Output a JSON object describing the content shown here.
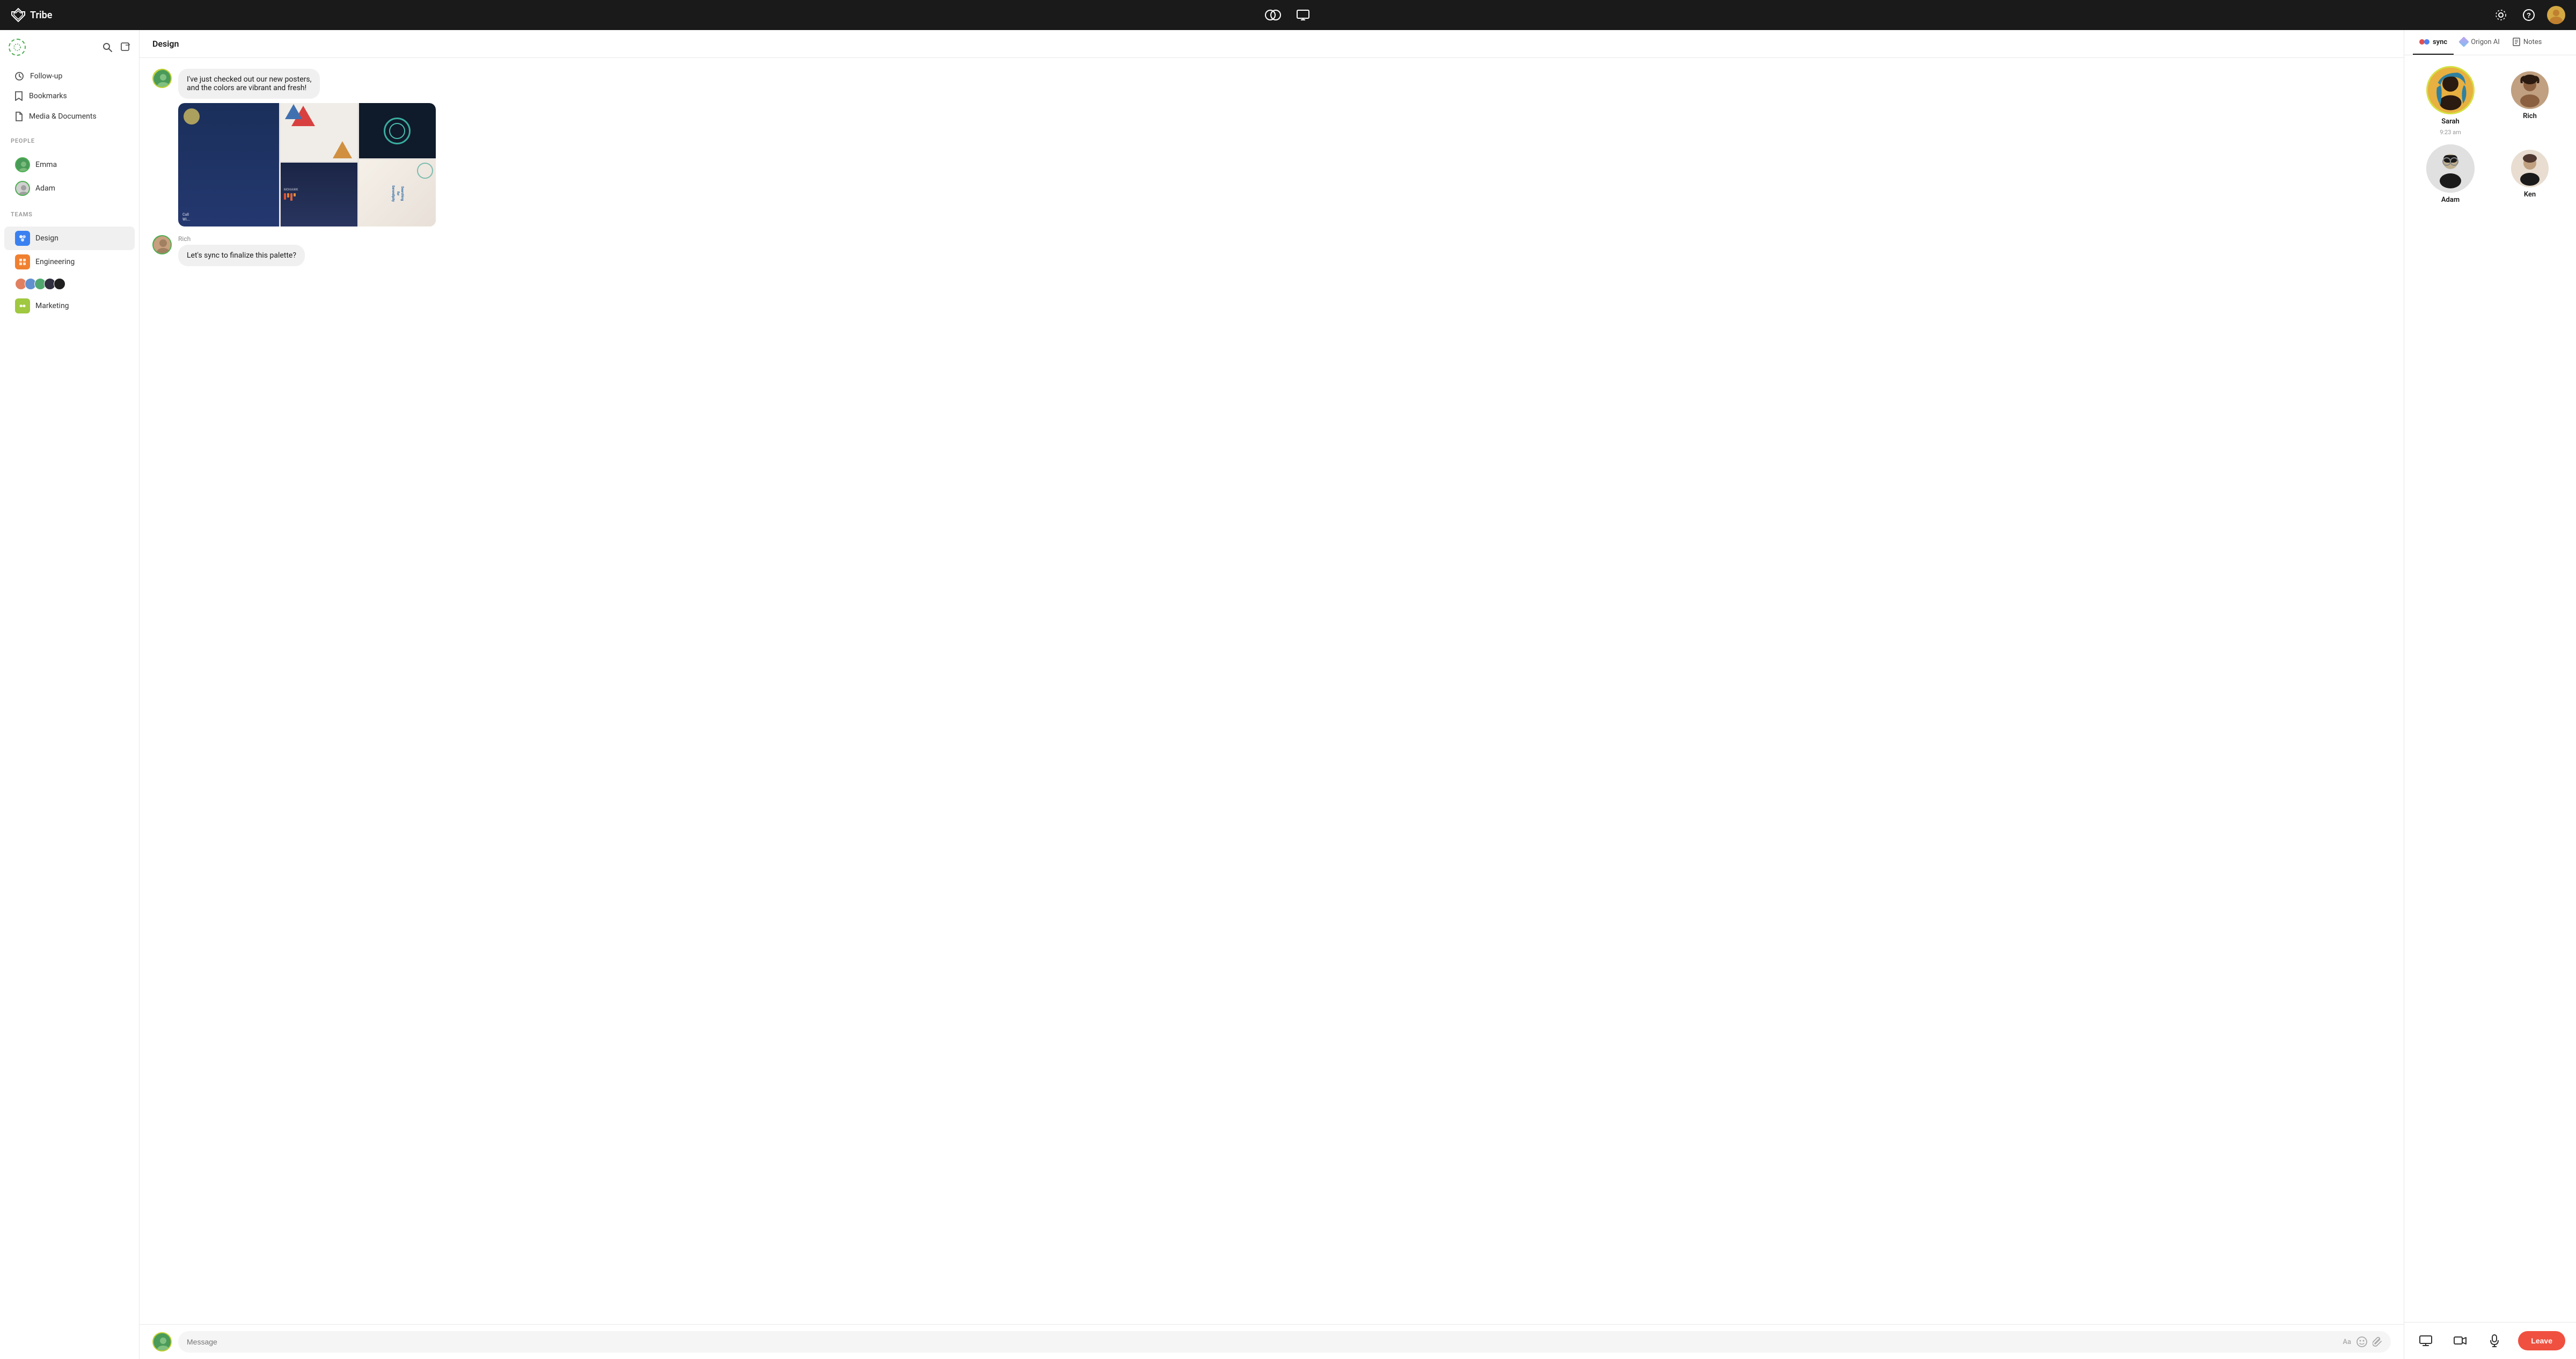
{
  "app": {
    "name": "Tribe",
    "logo_alt": "Tribe logo"
  },
  "topnav": {
    "center_icons": [
      "linked-circles",
      "screen-share"
    ],
    "right_icons": [
      "settings",
      "help"
    ],
    "user_avatar": "user-avatar"
  },
  "sidebar": {
    "sections": {
      "menu_items": [
        {
          "id": "follow-up",
          "label": "Follow-up",
          "icon": "clock"
        },
        {
          "id": "bookmarks",
          "label": "Bookmarks",
          "icon": "bookmark"
        },
        {
          "id": "media",
          "label": "Media & Documents",
          "icon": "document"
        }
      ],
      "people_label": "PEOPLE",
      "people": [
        {
          "id": "emma",
          "name": "Emma"
        },
        {
          "id": "adam",
          "name": "Adam"
        }
      ],
      "teams_label": "TEAMS",
      "teams": [
        {
          "id": "design",
          "name": "Design",
          "color": "#3a80f0",
          "active": true
        },
        {
          "id": "engineering",
          "name": "Engineering",
          "color": "#f08030"
        },
        {
          "id": "group",
          "name": "",
          "is_group": true
        },
        {
          "id": "marketing",
          "name": "Marketing",
          "color": "#a0c840"
        }
      ]
    }
  },
  "chat": {
    "channel": "Design",
    "messages": [
      {
        "id": "msg1",
        "sender": "",
        "text1": "I've just checked out our new posters,",
        "text2": "and the colors are vibrant and fresh!",
        "has_image": true,
        "avatar_color": "sarah"
      },
      {
        "id": "msg2",
        "sender": "Rich",
        "text": "Let's sync to finalize this palette?",
        "avatar_color": "rich"
      }
    ],
    "input_placeholder": "Message",
    "input_format_hint": "Aa"
  },
  "right_panel": {
    "tabs": [
      {
        "id": "sync",
        "label": "sync",
        "active": true
      },
      {
        "id": "origon",
        "label": "Origon AI"
      },
      {
        "id": "notes",
        "label": "Notes"
      }
    ],
    "members": [
      {
        "id": "sarah",
        "name": "Sarah",
        "time": "9:23 am",
        "size": "large",
        "col": 1,
        "row": 1
      },
      {
        "id": "rich",
        "name": "Rich",
        "size": "medium",
        "col": 2,
        "row": 1
      },
      {
        "id": "adam",
        "name": "Adam",
        "size": "large",
        "col": 1,
        "row": 2
      },
      {
        "id": "ken",
        "name": "Ken",
        "size": "medium",
        "col": 2,
        "row": 2
      }
    ],
    "controls": {
      "screen_icon": "screen",
      "video_icon": "video",
      "mic_icon": "microphone",
      "leave_label": "Leave"
    }
  }
}
